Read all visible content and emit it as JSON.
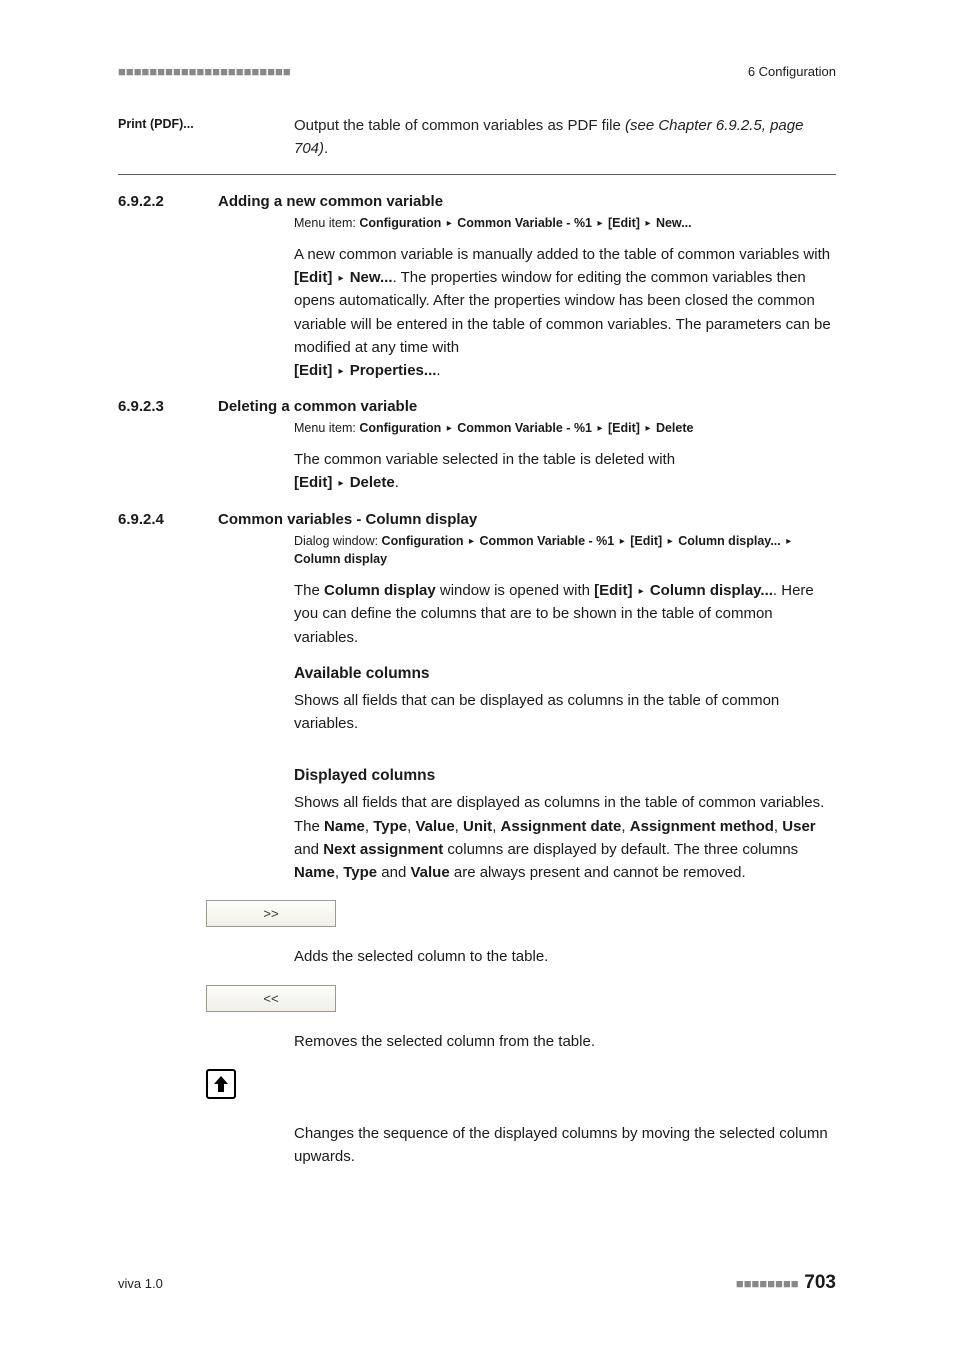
{
  "header": {
    "dashes": "■■■■■■■■■■■■■■■■■■■■■■",
    "section_label": "6 Configuration"
  },
  "print_row": {
    "label": "Print (PDF)...",
    "text_a": "Output the table of common variables as PDF file ",
    "text_i": "(see Chapter 6.9.2.5, page 704)",
    "text_b": "."
  },
  "s6922": {
    "num": "6.9.2.2",
    "title": "Adding a new common variable",
    "crumb_pre": "Menu item: ",
    "crumb_b1": "Configuration",
    "crumb_b2": "Common Variable - %1",
    "crumb_b3": "[Edit]",
    "crumb_b4": "New...",
    "p_a": "A new common variable is manually added to the table of common variables with ",
    "p_b1": "[Edit]",
    "p_b2": "New...",
    "p_c": ". The properties window for editing the common variables then opens automatically. After the properties window has been closed the common variable will be entered in the table of common variables. The parameters can be modified at any time with",
    "p_d1": "[Edit]",
    "p_d2": "Properties...",
    "p_e": "."
  },
  "s6923": {
    "num": "6.9.2.3",
    "title": "Deleting a common variable",
    "crumb_pre": "Menu item: ",
    "crumb_b1": "Configuration",
    "crumb_b2": "Common Variable - %1",
    "crumb_b3": "[Edit]",
    "crumb_b4": "Delete",
    "p_a": "The common variable selected in the table is deleted with",
    "p_b1": "[Edit]",
    "p_b2": "Delete",
    "p_c": "."
  },
  "s6924": {
    "num": "6.9.2.4",
    "title": "Common variables - Column display",
    "crumb_pre": "Dialog window: ",
    "crumb_b1": "Configuration",
    "crumb_b2": "Common Variable - %1",
    "crumb_b3": "[Edit]",
    "crumb_b4": "Column display...",
    "crumb_b5": "Column display",
    "p_a": "The ",
    "p_b1": "Column display",
    "p_c": " window is opened with ",
    "p_b2": "[Edit]",
    "p_b3": "Column display...",
    "p_d": ". Here you can define the columns that are to be shown in the table of common variables.",
    "avail_head": "Available columns",
    "avail_text": "Shows all fields that can be displayed as columns in the table of common variables.",
    "disp_head": "Displayed columns",
    "disp_a": "Shows all fields that are displayed as columns in the table of common variables. The ",
    "disp_n1": "Name",
    "disp_n2": "Type",
    "disp_n3": "Value",
    "disp_n4": "Unit",
    "disp_n5": "Assignment date",
    "disp_n6": "Assignment method",
    "disp_n7": "User",
    "disp_n8": "Next assignment",
    "disp_mid": " columns are displayed by default. The three columns ",
    "disp_end": " are always present and cannot be removed.",
    "disp_sep": ", ",
    "disp_and": " and ",
    "add_btn": ">>",
    "add_text": "Adds the selected column to the table.",
    "rem_btn": "<<",
    "rem_text": "Removes the selected column from the table.",
    "up_text": "Changes the sequence of the displayed columns by moving the selected column upwards."
  },
  "footer": {
    "left": "viva 1.0",
    "dashes": "■■■■■■■■",
    "page": "703"
  },
  "glyph": {
    "tri": "▸"
  }
}
